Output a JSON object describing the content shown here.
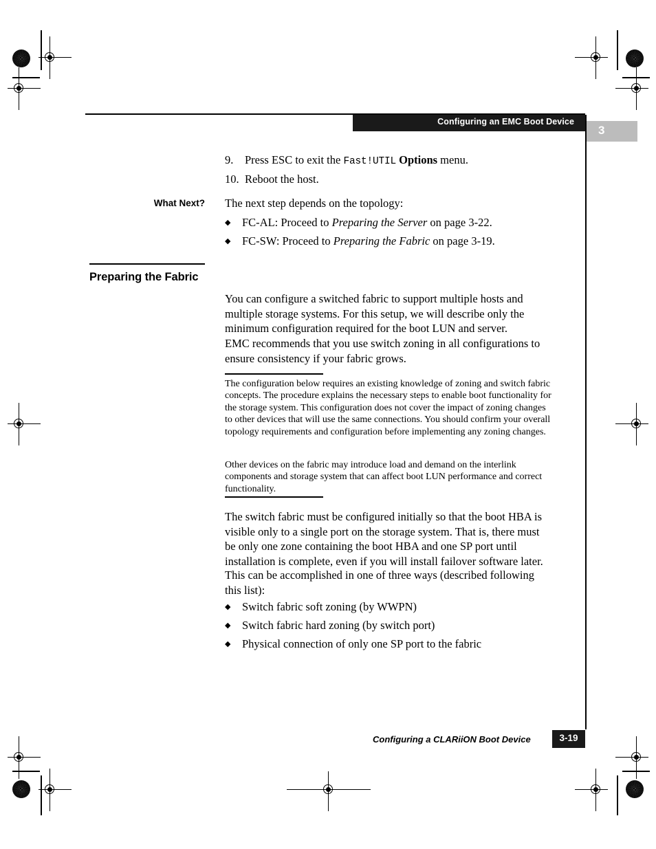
{
  "header": {
    "title": "Configuring an EMC Boot Device",
    "chapter_number": "3"
  },
  "steps": [
    {
      "number": "9.",
      "parts": [
        {
          "text": "Press ESC to exit the ",
          "style": "normal"
        },
        {
          "text": "Fast!UTIL",
          "style": "mono"
        },
        {
          "text": " ",
          "style": "normal"
        },
        {
          "text": "Options",
          "style": "bold"
        },
        {
          "text": " menu.",
          "style": "normal"
        }
      ],
      "plain": "Press ESC to exit the Fast!UTIL Options menu."
    },
    {
      "number": "10.",
      "parts": [
        {
          "text": "Reboot the host.",
          "style": "normal"
        }
      ],
      "plain": "Reboot the host."
    }
  ],
  "what_next": {
    "label": "What Next?",
    "intro": "The next step depends on the topology:",
    "bullets": [
      {
        "glyph": "◆",
        "lead": "FC-AL: Proceed to ",
        "italic": "Preparing the Server",
        "tail": " on page 3-22."
      },
      {
        "glyph": "◆",
        "lead": "FC-SW: Proceed to ",
        "italic": "Preparing the Fabric",
        "tail": " on page 3-19."
      }
    ]
  },
  "section": {
    "heading": "Preparing the Fabric",
    "paragraphs": [
      "You can configure a switched fabric to support multiple hosts and multiple storage systems. For this setup, we will describe only the minimum configuration required for the boot LUN and server.",
      "EMC recommends that you use switch zoning in all configurations to ensure consistency if your fabric grows."
    ],
    "note": {
      "paragraphs": [
        "The configuration below requires an existing knowledge of zoning and switch fabric concepts. The procedure explains the necessary steps to enable boot functionality for the storage system. This configuration does not cover the impact of zoning changes to other devices that will use the same connections. You should confirm your overall topology requirements and configuration before implementing any zoning changes.",
        "Other devices on the fabric may introduce load and demand on the interlink components and storage system that can affect boot LUN performance and correct functionality."
      ]
    },
    "paragraphs_after": [
      "The switch fabric must be configured initially so that the boot HBA is visible only to a single port on the storage system. That is, there must be only one zone containing the boot HBA and one SP port until installation is complete, even if you will install failover software later.",
      "This can be accomplished in one of three ways (described following this list):"
    ],
    "bullets": [
      {
        "glyph": "◆",
        "text": "Switch fabric soft zoning (by WWPN)"
      },
      {
        "glyph": "◆",
        "text": "Switch fabric hard zoning (by switch port)"
      },
      {
        "glyph": "◆",
        "text": "Physical connection of only one SP port to the fabric"
      }
    ]
  },
  "footer": {
    "text": "Configuring a CLARiiON Boot Device",
    "page_number": "3-19"
  },
  "colors": {
    "header_bar": "#1a1a1a",
    "chapter_tab": "#bcbcbc",
    "rule": "#000000",
    "page_background": "#ffffff"
  }
}
